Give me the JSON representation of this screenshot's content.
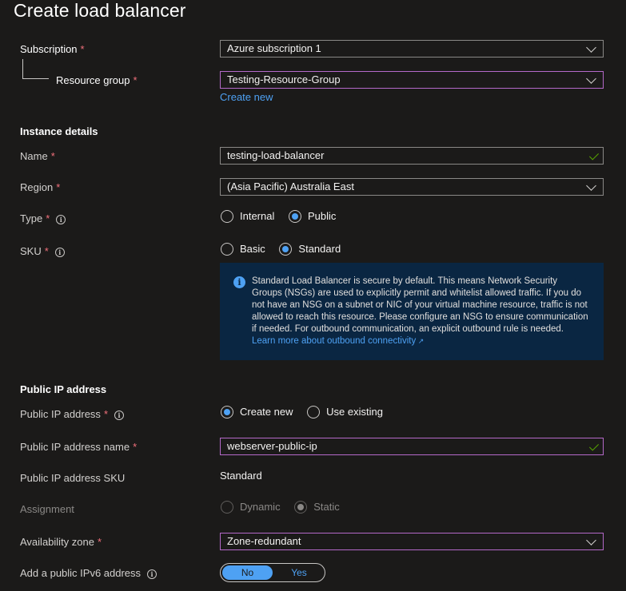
{
  "page": {
    "title": "Create load balancer"
  },
  "subscription": {
    "label": "Subscription",
    "value": "Azure subscription 1"
  },
  "resource_group": {
    "label": "Resource group",
    "value": "Testing-Resource-Group",
    "create_new": "Create new"
  },
  "instance_details": {
    "heading": "Instance details",
    "name": {
      "label": "Name",
      "value": "testing-load-balancer"
    },
    "region": {
      "label": "Region",
      "value": "(Asia Pacific) Australia East"
    },
    "type": {
      "label": "Type",
      "options": [
        "Internal",
        "Public"
      ],
      "selected": "Public"
    },
    "sku": {
      "label": "SKU",
      "options": [
        "Basic",
        "Standard"
      ],
      "selected": "Standard"
    }
  },
  "info_box": {
    "text": "Standard Load Balancer is secure by default.  This means Network Security Groups (NSGs) are used to explicitly permit and whitelist allowed traffic. If you do not have an NSG on a subnet or NIC of your virtual machine resource, traffic is not allowed to reach this resource. Please configure an NSG to ensure communication if needed.  For outbound communication, an explicit outbound rule is needed.",
    "link": "Learn more about outbound connectivity"
  },
  "public_ip": {
    "heading": "Public IP address",
    "address": {
      "label": "Public IP address",
      "options": [
        "Create new",
        "Use existing"
      ],
      "selected": "Create new"
    },
    "name": {
      "label": "Public IP address name",
      "value": "webserver-public-ip"
    },
    "sku": {
      "label": "Public IP address SKU",
      "value": "Standard"
    },
    "assignment": {
      "label": "Assignment",
      "options": [
        "Dynamic",
        "Static"
      ],
      "selected": "Static"
    },
    "availability_zone": {
      "label": "Availability zone",
      "value": "Zone-redundant"
    },
    "ipv6": {
      "label": "Add a public IPv6 address",
      "off": "No",
      "on": "Yes",
      "selected": "No"
    }
  },
  "required_marker": "*",
  "colors": {
    "background": "#1b1a19",
    "accent": "#4ea1f3",
    "required": "#f1707b",
    "valid": "#57a300",
    "focus_border": "#b469c9",
    "info_bg": "#0a2642"
  }
}
